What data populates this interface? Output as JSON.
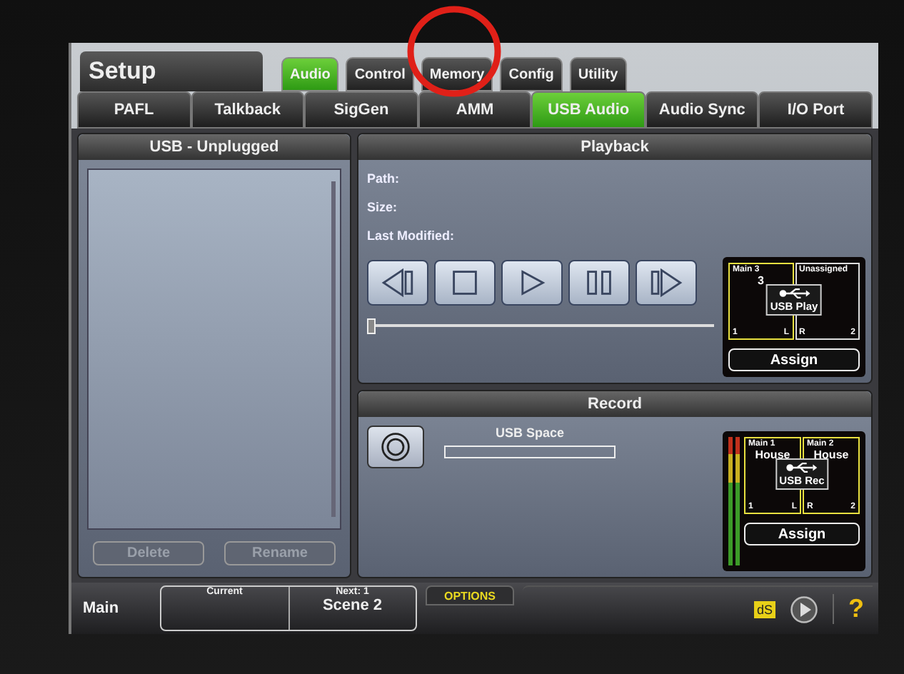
{
  "screen": {
    "title": "Setup",
    "tabs": [
      {
        "label": "Audio",
        "selected": true
      },
      {
        "label": "Control",
        "selected": false
      },
      {
        "label": "Memory",
        "selected": false
      },
      {
        "label": "Config",
        "selected": false
      },
      {
        "label": "Utility",
        "selected": false
      }
    ],
    "subtabs": [
      {
        "label": "PAFL",
        "selected": false
      },
      {
        "label": "Talkback",
        "selected": false
      },
      {
        "label": "SigGen",
        "selected": false
      },
      {
        "label": "AMM",
        "selected": false
      },
      {
        "label": "USB Audio",
        "selected": true
      },
      {
        "label": "Audio Sync",
        "selected": false
      },
      {
        "label": "I/O Port",
        "selected": false
      }
    ],
    "usb_panel": {
      "title": "USB - Unplugged",
      "buttons": [
        {
          "label": "Delete",
          "disabled": true
        },
        {
          "label": "Rename",
          "disabled": true
        }
      ]
    },
    "playback": {
      "title": "Playback",
      "fields": [
        "Path:",
        "Size:",
        "Last Modified:"
      ],
      "transport": [
        {
          "kind": "rewind"
        },
        {
          "kind": "stop"
        },
        {
          "kind": "play"
        },
        {
          "kind": "pause"
        },
        {
          "kind": "forward"
        }
      ],
      "position_slider": {
        "level": 0
      },
      "routing": {
        "slots": [
          {
            "label": "Main 3",
            "name": "3",
            "number": "1",
            "side": "L",
            "assigned": true
          },
          {
            "label": "Unassigned",
            "number": "2",
            "side": "R",
            "assigned": false
          }
        ],
        "center": "USB Play",
        "assign": "Assign"
      }
    },
    "record": {
      "title": "Record",
      "space_label": "USB Space",
      "space_meter": {
        "level": 0
      },
      "routing": {
        "slots": [
          {
            "label": "Main 1",
            "name": "House",
            "number": "1",
            "side": "L",
            "assigned": true
          },
          {
            "label": "Main 2",
            "name": "House",
            "number": "2",
            "side": "R",
            "assigned": true
          }
        ],
        "center": "USB Rec",
        "assign": "Assign"
      }
    },
    "footer": {
      "label": "Main",
      "current_label": "Current",
      "next_label": "Next: 1",
      "next_scene": "Scene 2",
      "options": "OPTIONS",
      "ds": "dS",
      "help": "?"
    }
  },
  "annotation": {
    "kind": "circle"
  }
}
